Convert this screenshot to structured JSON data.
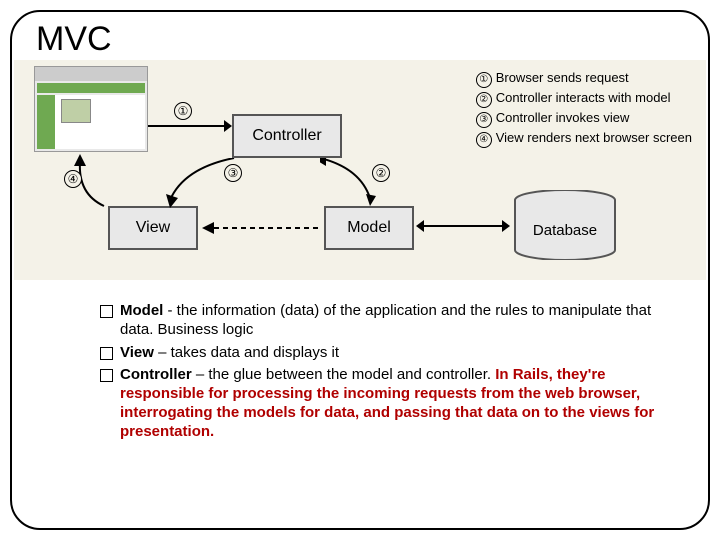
{
  "title": "MVC",
  "steps": [
    {
      "n": "①",
      "text": "Browser sends request"
    },
    {
      "n": "②",
      "text": "Controller interacts with model"
    },
    {
      "n": "③",
      "text": "Controller invokes view"
    },
    {
      "n": "④",
      "text": "View renders next browser screen"
    }
  ],
  "boxes": {
    "controller": "Controller",
    "view": "View",
    "model": "Model",
    "database": "Database"
  },
  "circles": {
    "c1": "①",
    "c2": "②",
    "c3": "③",
    "c4": "④"
  },
  "bullets": [
    {
      "bold": "Model",
      "plain": " - the information (data) of the application and the rules to manipulate that data. Business logic",
      "hl": ""
    },
    {
      "bold": "View",
      "plain": " – takes data and displays it",
      "hl": ""
    },
    {
      "bold": "Controller",
      "plain": " – the glue between the model and controller. ",
      "hl": "In Rails, they're responsible for processing the incoming requests from the web browser, interrogating the models for data, and passing that data on to the views for presentation."
    }
  ]
}
